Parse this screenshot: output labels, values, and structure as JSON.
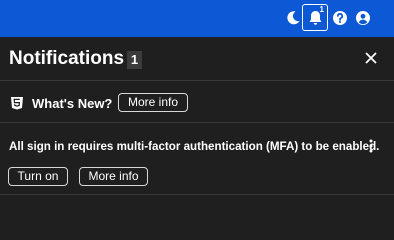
{
  "topbar": {
    "icons": [
      "moon-icon",
      "bell-icon",
      "help-icon",
      "user-icon"
    ],
    "bell_badge": "1",
    "colors": {
      "background": "#0d58d4"
    }
  },
  "panel": {
    "title": "Notifications",
    "count": "1",
    "close_icon": "close-icon"
  },
  "whats_new": {
    "icon": "html5-icon",
    "label": "What's New?",
    "more_info_label": "More info"
  },
  "notification": {
    "message": "All sign in requires multi-factor authentication (MFA) to be enabled.",
    "turn_on_label": "Turn on",
    "more_info_label": "More info",
    "menu_icon": "kebab-menu-icon"
  }
}
